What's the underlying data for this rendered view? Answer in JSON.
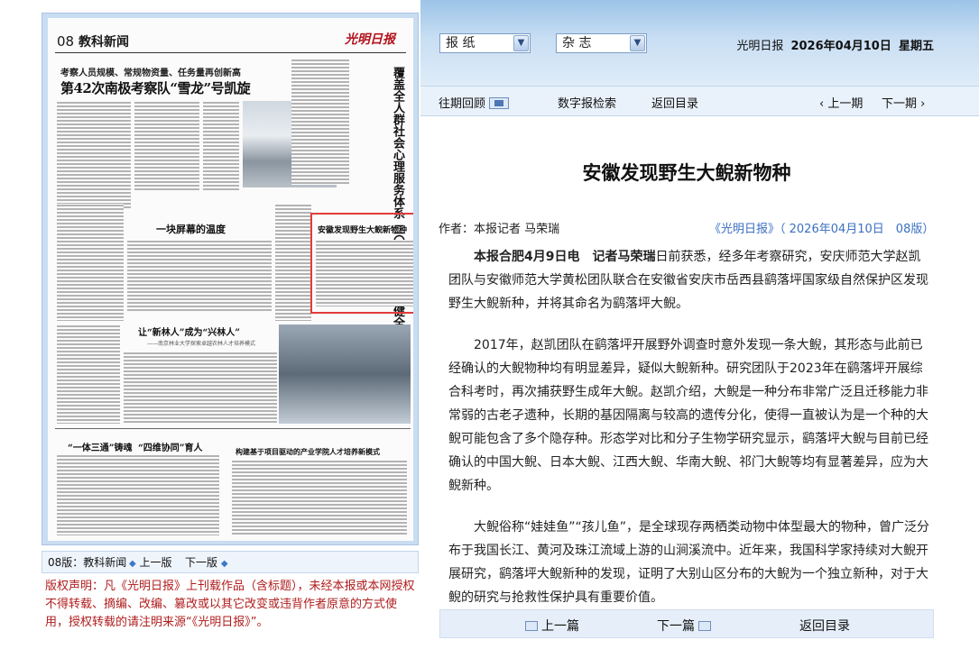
{
  "header": {
    "select_newspaper": "报 纸",
    "select_magazine": "杂 志",
    "site_name": "光明日报",
    "date": "2026年04月10日",
    "weekday": "星期五"
  },
  "nav": {
    "past_review": "往期回顾",
    "digital_search": "数字报检索",
    "back_to_index": "返回目录",
    "prev_issue": "上一期",
    "next_issue": "下一期"
  },
  "page": {
    "number": "08",
    "section": "教科新闻",
    "logo": "光明日报",
    "kicker": "考察人员规模、常规物资量、任务量再创新高",
    "headline": "第42次南极考察队“雪龙”号凯旋",
    "vertical_headline": "覆盖全人群社会心理服务体系 二〇三〇年基本健全",
    "mid_headline": "一块屏幕的温度",
    "highlighted_headline": "安徽发现野生大鲵新物种",
    "headline_3": "让“新林人”成为“兴林人”",
    "headline_3_sub": "——南京林业大学探索卓越农林人才培养模式",
    "headline_4": "“一体三通”铸魂",
    "headline_5": "“四维协同”育人",
    "headline_6": "构建基于项目驱动的产业学院人才培养新模式"
  },
  "page_footer": {
    "label": "08版：教科新闻",
    "prev_page": "上一版",
    "next_page": "下一版"
  },
  "copyright": "版权声明：凡《光明日报》上刊载作品（含标题），未经本报或本网授权不得转载、摘编、改编、篡改或以其它改变或违背作者原意的方式使用，授权转载的请注明来源“《光明日报》”。",
  "article": {
    "title": "安徽发现野生大鲵新物种",
    "author": "作者：本报记者 马荣瑞",
    "source": "《光明日报》（ 2026年04月10日　08版）",
    "lead_bold": "本报合肥4月9日电　记者马荣瑞",
    "p1": "日前获悉，经多年考察研究，安庆师范大学赵凯团队与安徽师范大学黄松团队联合在安徽省安庆市岳西县鹞落坪国家级自然保护区发现野生大鲵新种，并将其命名为鹞落坪大鲵。",
    "p2": "2017年，赵凯团队在鹞落坪开展野外调查时意外发现一条大鲵，其形态与此前已经确认的大鲵物种均有明显差异，疑似大鲵新种。研究团队于2023年在鹞落坪开展综合科考时，再次捕获野生成年大鲵。赵凯介绍，大鲵是一种分布非常广泛且迁移能力非常弱的古老孑遗种，长期的基因隔离与较高的遗传分化，使得一直被认为是一个种的大鲵可能包含了多个隐存种。形态学对比和分子生物学研究显示，鹞落坪大鲵与目前已经确认的中国大鲵、日本大鲵、江西大鲵、华南大鲵、祁门大鲵等均有显著差异，应为大鲵新种。",
    "p3": "大鲵俗称“娃娃鱼”“孩儿鱼”，是全球现存两栖类动物中体型最大的物种，曾广泛分布于我国长江、黄河及珠江流域上游的山涧溪流中。近年来，我国科学家持续对大鲵开展研究，鹞落坪大鲵新种的发现，证明了大别山区分布的大鲵为一个独立新种，对于大鲵的研究与抢救性保护具有重要价值。"
  },
  "bottom_nav": {
    "prev": "上一篇",
    "next": "下一篇",
    "back": "返回目录"
  },
  "colors": {
    "header_blue": "#9cc4e8",
    "copyright_red": "#b01c1c",
    "source_blue": "#3a6fc0",
    "highlight_box": "#e23b3b"
  }
}
